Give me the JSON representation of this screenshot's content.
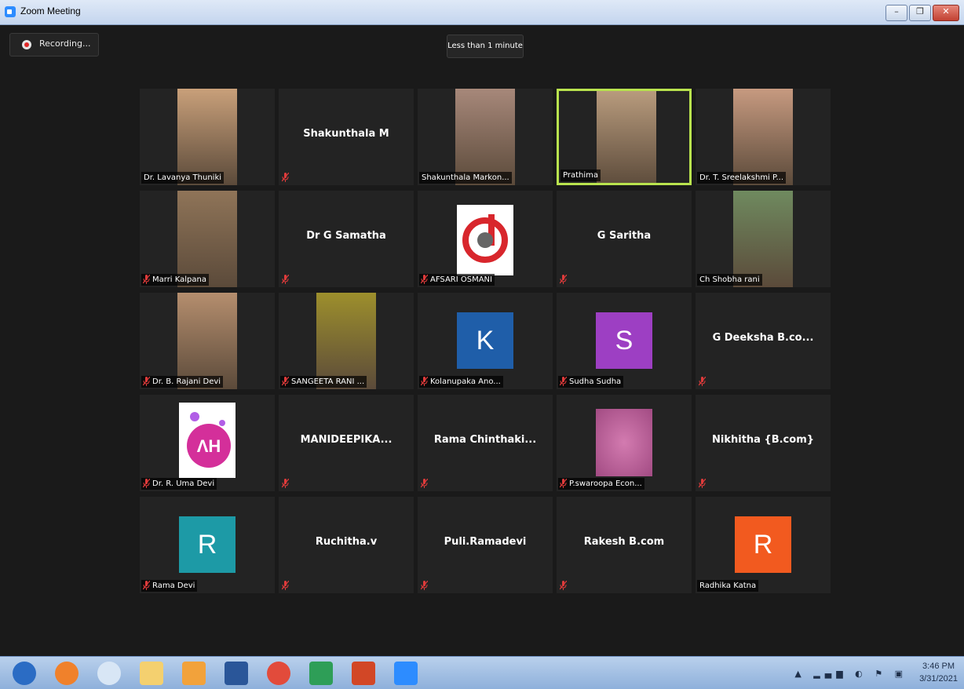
{
  "window": {
    "title": "Zoom Meeting",
    "minimize_glyph": "–",
    "maximize_glyph": "❐",
    "close_glyph": "✕"
  },
  "meeting": {
    "recording_label": "Recording...",
    "timer_label": "Less than 1 minute"
  },
  "participants": [
    {
      "name_label": "Dr. Lavanya Thuniki",
      "big_name": "",
      "muted": false,
      "kind": "photo",
      "photo_color": "#c9a07a",
      "active": false
    },
    {
      "name_label": "",
      "big_name": "Shakunthala M",
      "muted": true,
      "kind": "name",
      "active": false
    },
    {
      "name_label": "Shakunthala Markon...",
      "big_name": "",
      "muted": false,
      "kind": "photo",
      "photo_color": "#a7887a",
      "active": false
    },
    {
      "name_label": "Prathima",
      "big_name": "",
      "muted": false,
      "kind": "photo",
      "photo_color": "#b89b7d",
      "active": true
    },
    {
      "name_label": "Dr. T. Sreelakshmi P...",
      "big_name": "",
      "muted": false,
      "kind": "photo",
      "photo_color": "#c79a80",
      "active": false
    },
    {
      "name_label": "Marri Kalpana",
      "big_name": "",
      "muted": true,
      "kind": "photo",
      "photo_color": "#8f7458",
      "active": false
    },
    {
      "name_label": "",
      "big_name": "Dr G Samatha",
      "muted": true,
      "kind": "name",
      "active": false
    },
    {
      "name_label": "AFSARI OSMANI",
      "big_name": "",
      "muted": true,
      "kind": "logo",
      "active": false
    },
    {
      "name_label": "",
      "big_name": "G Saritha",
      "muted": true,
      "kind": "name",
      "active": false
    },
    {
      "name_label": "Ch Shobha rani",
      "big_name": "",
      "muted": false,
      "kind": "photo",
      "photo_color": "#6f8a5f",
      "active": false
    },
    {
      "name_label": "Dr. B. Rajani Devi",
      "big_name": "",
      "muted": true,
      "kind": "photo",
      "photo_color": "#b58e6e",
      "active": false
    },
    {
      "name_label": "SANGEETA RANI ...",
      "big_name": "",
      "muted": true,
      "kind": "photo",
      "photo_color": "#9d8f2c",
      "active": false
    },
    {
      "name_label": "Kolanupaka Ano...",
      "big_name": "",
      "muted": true,
      "kind": "letter",
      "letter": "K",
      "letter_bg": "#1f5ea9",
      "active": false
    },
    {
      "name_label": "Sudha Sudha",
      "big_name": "",
      "muted": true,
      "kind": "letter",
      "letter": "S",
      "letter_bg": "#9d3fc3",
      "active": false
    },
    {
      "name_label": "",
      "big_name": "G Deeksha B.co...",
      "muted": true,
      "kind": "name",
      "active": false
    },
    {
      "name_label": "Dr. R. Uma Devi",
      "big_name": "",
      "muted": true,
      "kind": "logo2",
      "active": false
    },
    {
      "name_label": "",
      "big_name": "MANIDEEPIKA...",
      "muted": true,
      "kind": "name",
      "active": false
    },
    {
      "name_label": "",
      "big_name": "Rama  Chinthaki...",
      "muted": true,
      "kind": "name",
      "active": false
    },
    {
      "name_label": "P.swaroopa Econ...",
      "big_name": "",
      "muted": true,
      "kind": "blur",
      "active": false
    },
    {
      "name_label": "",
      "big_name": "Nikhitha {B.com}",
      "muted": true,
      "kind": "name",
      "active": false
    },
    {
      "name_label": "Rama Devi",
      "big_name": "",
      "muted": true,
      "kind": "letter",
      "letter": "R",
      "letter_bg": "#1d9aa6",
      "active": false
    },
    {
      "name_label": "",
      "big_name": "Ruchitha.v",
      "muted": true,
      "kind": "name",
      "active": false
    },
    {
      "name_label": "",
      "big_name": "Puli.Ramadevi",
      "muted": true,
      "kind": "name",
      "active": false
    },
    {
      "name_label": "",
      "big_name": "Rakesh B.com",
      "muted": true,
      "kind": "name",
      "active": false
    },
    {
      "name_label": "Radhika Katna",
      "big_name": "",
      "muted": false,
      "kind": "letter",
      "letter": "R",
      "letter_bg": "#f25a1f",
      "active": false
    }
  ],
  "taskbar": {
    "apps": [
      "start-orb",
      "firefox",
      "chrome-canary",
      "file-manager",
      "media-player",
      "word",
      "chrome",
      "sheets",
      "powerpoint",
      "zoom"
    ],
    "tray_glyphs": "▲ ▂▄▆ ◐ ⚑ ▣",
    "clock_time": "3:46 PM",
    "clock_date": "3/31/2021"
  }
}
